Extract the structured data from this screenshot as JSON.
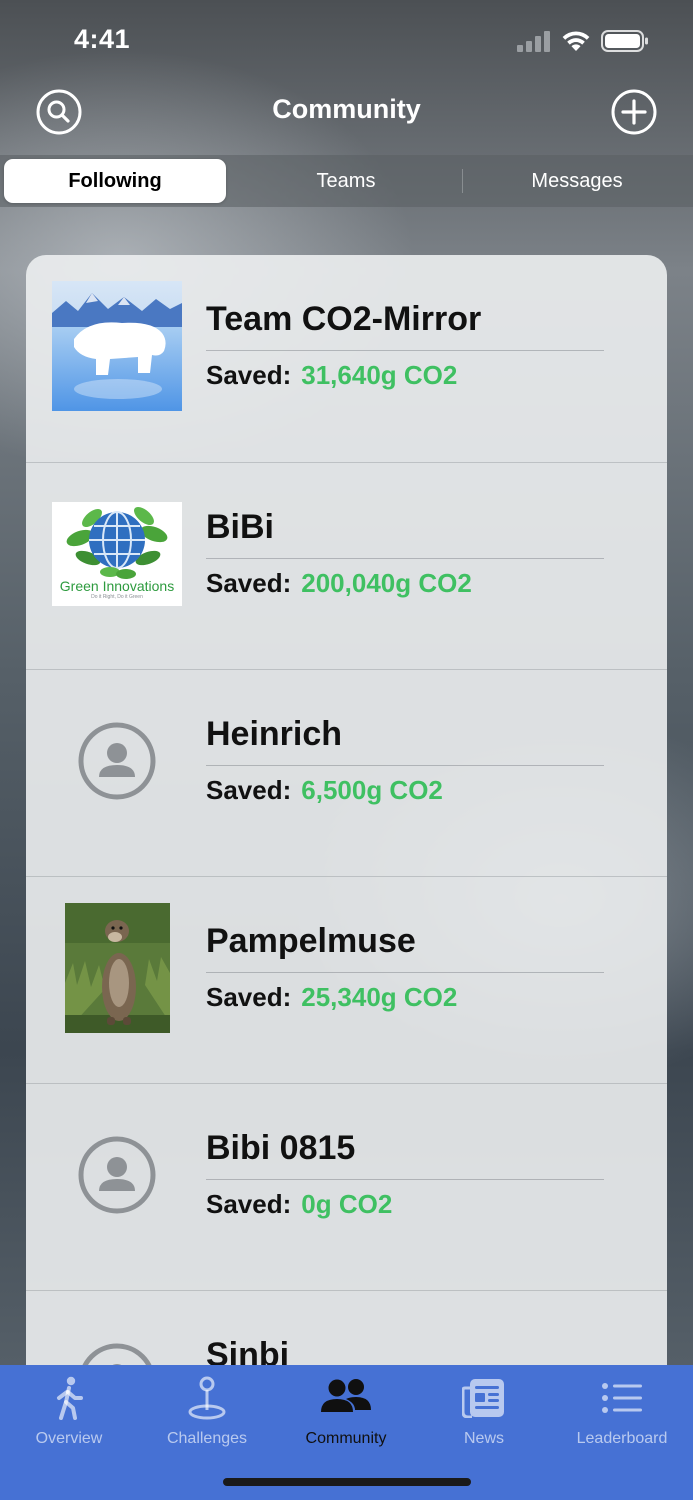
{
  "status_bar": {
    "time": "4:41",
    "signal_icon": "cellular-signal-icon",
    "wifi_icon": "wifi-icon",
    "battery_icon": "battery-icon"
  },
  "nav": {
    "title": "Community",
    "search_icon": "search-icon",
    "add_icon": "plus-circle-icon"
  },
  "segments": [
    {
      "label": "Following",
      "selected": true
    },
    {
      "label": "Teams",
      "selected": false
    },
    {
      "label": "Messages",
      "selected": false
    }
  ],
  "list": [
    {
      "name": "Team CO2-Mirror",
      "saved_label": "Saved:",
      "saved_value": "31,640g CO2",
      "avatar": "polar-bear-image"
    },
    {
      "name": "BiBi",
      "saved_label": "Saved:",
      "saved_value": "200,040g CO2",
      "avatar": "green-innovations-logo",
      "logo_text": "Green Innovations",
      "logo_tagline": "Do it Right, Do it Green"
    },
    {
      "name": "Heinrich",
      "saved_label": "Saved:",
      "saved_value": "6,500g CO2",
      "avatar": "default-user-icon"
    },
    {
      "name": "Pampelmuse",
      "saved_label": "Saved:",
      "saved_value": "25,340g CO2",
      "avatar": "otter-photo"
    },
    {
      "name": "Bibi 0815",
      "saved_label": "Saved:",
      "saved_value": "0g CO2",
      "avatar": "default-user-icon"
    },
    {
      "name": "Sinbi",
      "avatar": "default-user-icon"
    }
  ],
  "tabs": [
    {
      "label": "Overview",
      "icon": "walking-person-icon",
      "selected": false
    },
    {
      "label": "Challenges",
      "icon": "map-pin-icon",
      "selected": false
    },
    {
      "label": "Community",
      "icon": "people-icon",
      "selected": true
    },
    {
      "label": "News",
      "icon": "newspaper-icon",
      "selected": false
    },
    {
      "label": "Leaderboard",
      "icon": "list-icon",
      "selected": false
    }
  ],
  "colors": {
    "accent_green": "#3fc062",
    "tab_bar": "#4671d4",
    "active_tab": "#101010"
  }
}
